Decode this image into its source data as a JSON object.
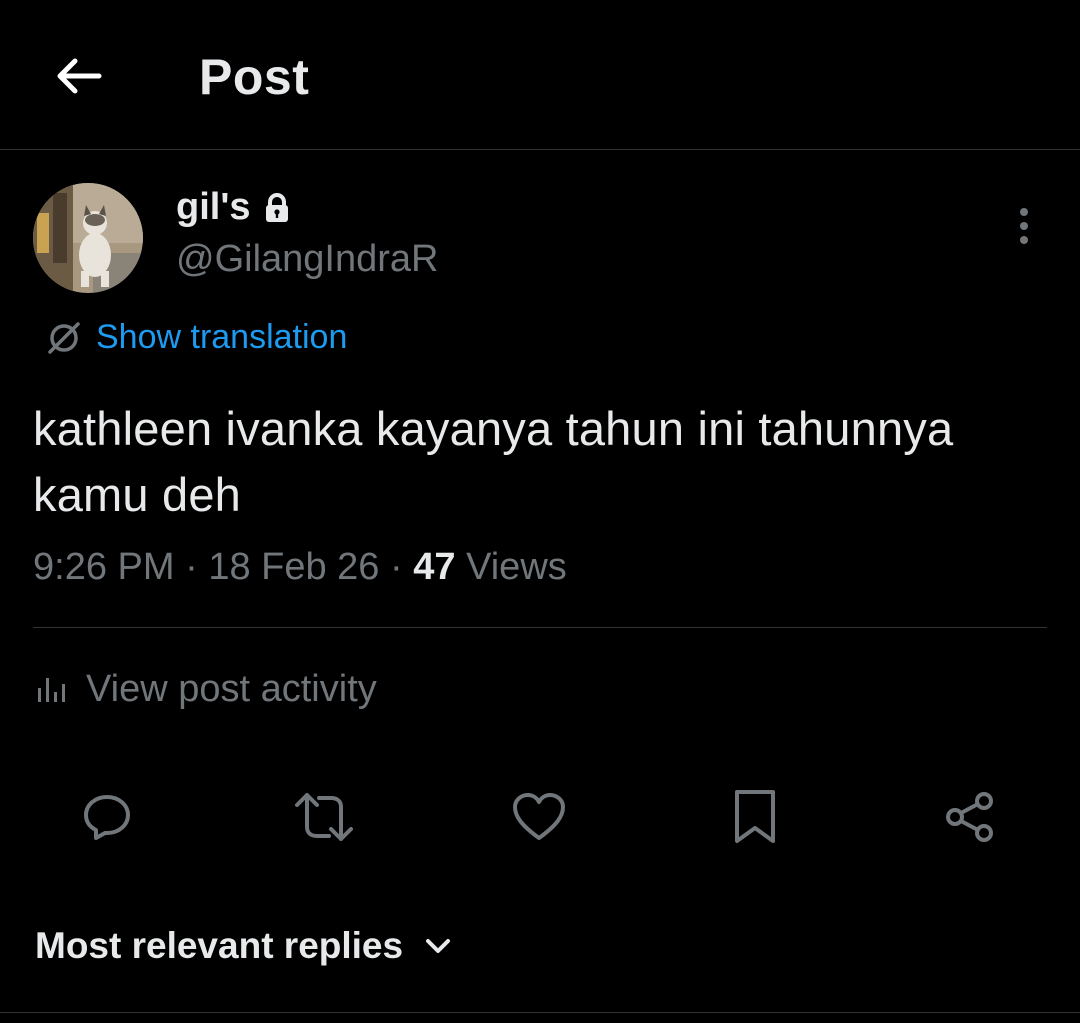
{
  "header": {
    "title": "Post",
    "back_icon": "arrow-left-icon"
  },
  "author": {
    "display_name": "gil's",
    "handle": "@GilangIndraR",
    "protected_icon": "lock-icon",
    "avatar": "cat-photo"
  },
  "translation": {
    "label": "Show translation",
    "icon": "globe-icon"
  },
  "post": {
    "text": "kathleen ivanka kayanya tahun ini tahunnya kamu deh",
    "time": "9:26 PM",
    "date": "18 Feb 26",
    "separator": "·",
    "views_count": "47",
    "views_label": "Views"
  },
  "activity": {
    "label": "View post activity",
    "icon": "bar-chart-icon"
  },
  "actions": [
    {
      "name": "reply",
      "icon": "reply-icon"
    },
    {
      "name": "repost",
      "icon": "repost-icon"
    },
    {
      "name": "like",
      "icon": "heart-icon"
    },
    {
      "name": "bookmark",
      "icon": "bookmark-icon"
    },
    {
      "name": "share",
      "icon": "share-icon"
    }
  ],
  "replies_sort": {
    "label": "Most relevant replies",
    "icon": "chevron-down-icon"
  },
  "colors": {
    "background": "#000000",
    "text_primary": "#e7e9ea",
    "text_secondary": "#71767b",
    "accent": "#1d9bf0",
    "divider": "#2f3336"
  }
}
